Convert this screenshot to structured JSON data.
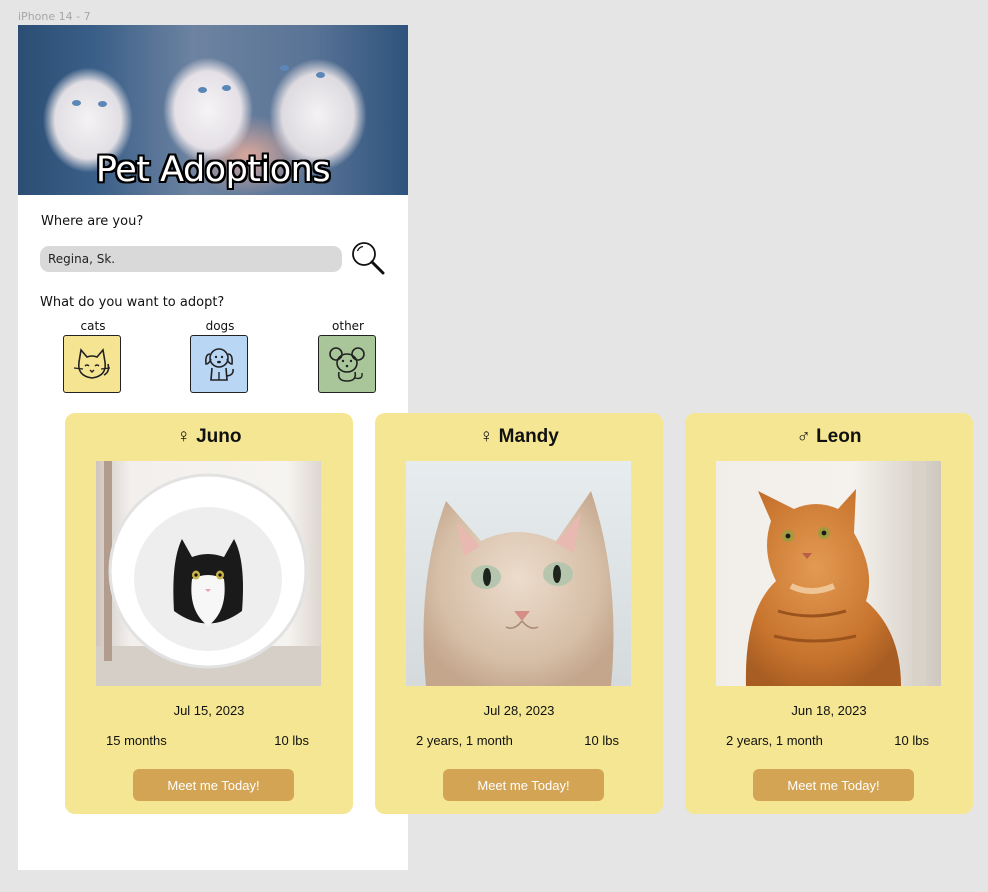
{
  "frame": {
    "label": "iPhone 14 - 7"
  },
  "hero": {
    "title": "Pet Adoptions"
  },
  "location": {
    "question": "Where are you?",
    "value": "Regina, Sk.",
    "search_icon": "magnifier-icon"
  },
  "adopt": {
    "question": "What do you want to adopt?",
    "categories": [
      {
        "label": "cats",
        "icon": "cat-icon",
        "color": "#f5e592"
      },
      {
        "label": "dogs",
        "icon": "dog-icon",
        "color": "#b9d6f5"
      },
      {
        "label": "other",
        "icon": "mouse-icon",
        "color": "#a9c69a"
      }
    ]
  },
  "pets": [
    {
      "sex_symbol": "♀",
      "name": "Juno",
      "date": "Jul 15, 2023",
      "age": "15 months",
      "weight": "10 lbs",
      "button": "Meet me Today!"
    },
    {
      "sex_symbol": "♀",
      "name": "Mandy",
      "date": "Jul 28, 2023",
      "age": "2 years, 1 month",
      "weight": "10 lbs",
      "button": "Meet me Today!"
    },
    {
      "sex_symbol": "♂",
      "name": "Leon",
      "date": "Jun 18, 2023",
      "age": "2 years, 1 month",
      "weight": "10 lbs",
      "button": "Meet me Today!"
    }
  ],
  "colors": {
    "card": "#f4e692",
    "button": "#d4a455",
    "input": "#d9d9d9"
  }
}
